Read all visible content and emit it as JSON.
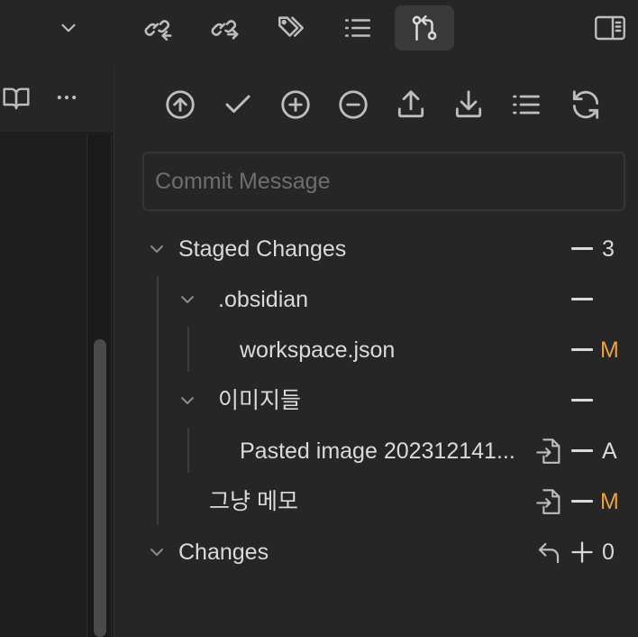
{
  "toolbar": {
    "icons": [
      "chevron-down-icon",
      "link-back-icon",
      "link-forward-icon",
      "tags-icon",
      "list-icon",
      "git-compare-icon",
      "sidebar-toggle-icon"
    ],
    "active": "git-compare-icon"
  },
  "left_pane": {
    "icons": [
      "book-open-icon",
      "more-horizontal-icon"
    ]
  },
  "source_control": {
    "actions": [
      "push-arrow-up-icon",
      "commit-check-icon",
      "stage-all-plus-icon",
      "unstage-all-minus-icon",
      "push-upload-icon",
      "pull-download-icon",
      "list-view-icon",
      "refresh-icon"
    ],
    "commit_placeholder": "Commit Message",
    "staged": {
      "label": "Staged Changes",
      "count": "3",
      "folders": [
        {
          "name": ".obsidian",
          "files": [
            {
              "name": "workspace.json",
              "status": "M"
            }
          ]
        },
        {
          "name": "이미지들",
          "files": [
            {
              "name": "Pasted image 202312141...",
              "status": "A"
            }
          ]
        }
      ],
      "root_files": [
        {
          "name": "그냥 메모",
          "status": "M"
        }
      ]
    },
    "changes": {
      "label": "Changes",
      "count": "0"
    }
  },
  "colors": {
    "modified": "#e9a23b",
    "added": "#dadada",
    "icon": "#bdbdbd",
    "background": "#262626"
  }
}
